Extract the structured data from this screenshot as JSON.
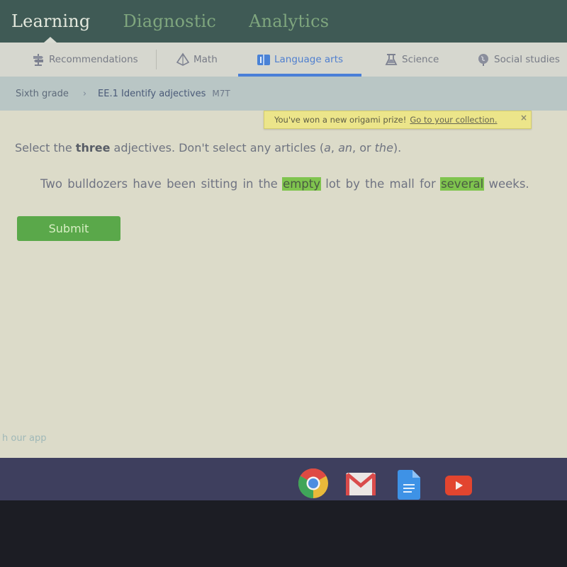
{
  "top_nav": {
    "items": [
      {
        "label": "Learning",
        "active": true
      },
      {
        "label": "Diagnostic",
        "active": false
      },
      {
        "label": "Analytics",
        "active": false
      }
    ]
  },
  "subjects": {
    "tabs": [
      {
        "label": "Recommendations",
        "icon": "signpost-icon",
        "active": false
      },
      {
        "label": "Math",
        "icon": "pyramid-icon",
        "active": false
      },
      {
        "label": "Language arts",
        "icon": "book-icon",
        "active": true
      },
      {
        "label": "Science",
        "icon": "flask-icon",
        "active": false
      },
      {
        "label": "Social studies",
        "icon": "globe-icon",
        "active": false
      }
    ]
  },
  "breadcrumb": {
    "grade": "Sixth grade",
    "separator": "›",
    "skill": "EE.1 Identify adjectives",
    "code": "M7T"
  },
  "notification": {
    "message": "You've won a new origami prize!",
    "link": "Go to your collection.",
    "close": "×"
  },
  "question": {
    "instruction_prefix": "Select the ",
    "instruction_bold": "three",
    "instruction_mid": " adjectives. Don't select any articles (",
    "article_a": "a",
    "comma1": ", ",
    "article_an": "an",
    "comma2": ", or ",
    "article_the": "the",
    "instruction_end": ").",
    "words": [
      {
        "text": "Two",
        "selected": false
      },
      {
        "text": "bulldozers",
        "selected": false
      },
      {
        "text": "have",
        "selected": false
      },
      {
        "text": "been",
        "selected": false
      },
      {
        "text": "sitting",
        "selected": false
      },
      {
        "text": "in",
        "selected": false
      },
      {
        "text": "the",
        "selected": false
      },
      {
        "text": "empty",
        "selected": true
      },
      {
        "text": "lot",
        "selected": false
      },
      {
        "text": "by",
        "selected": false
      },
      {
        "text": "the",
        "selected": false
      },
      {
        "text": "mall",
        "selected": false
      },
      {
        "text": "for",
        "selected": false
      },
      {
        "text": "several",
        "selected": true
      },
      {
        "text": "weeks.",
        "selected": false
      }
    ],
    "submit_label": "Submit"
  },
  "footer": {
    "app_link": "h our app"
  },
  "shelf": {
    "apps": [
      {
        "name": "Chrome",
        "icon": "chrome-icon",
        "running": true
      },
      {
        "name": "Gmail",
        "icon": "gmail-icon",
        "running": true
      },
      {
        "name": "Docs",
        "icon": "docs-icon",
        "running": false
      },
      {
        "name": "YouTube",
        "icon": "youtube-icon",
        "running": false
      }
    ]
  },
  "colors": {
    "nav_bg": "#3f5a55",
    "accent_blue": "#4a7fd8",
    "selected_green": "#7fc44e",
    "submit_green": "#5aa84a",
    "prize_yellow": "#ece58a"
  }
}
